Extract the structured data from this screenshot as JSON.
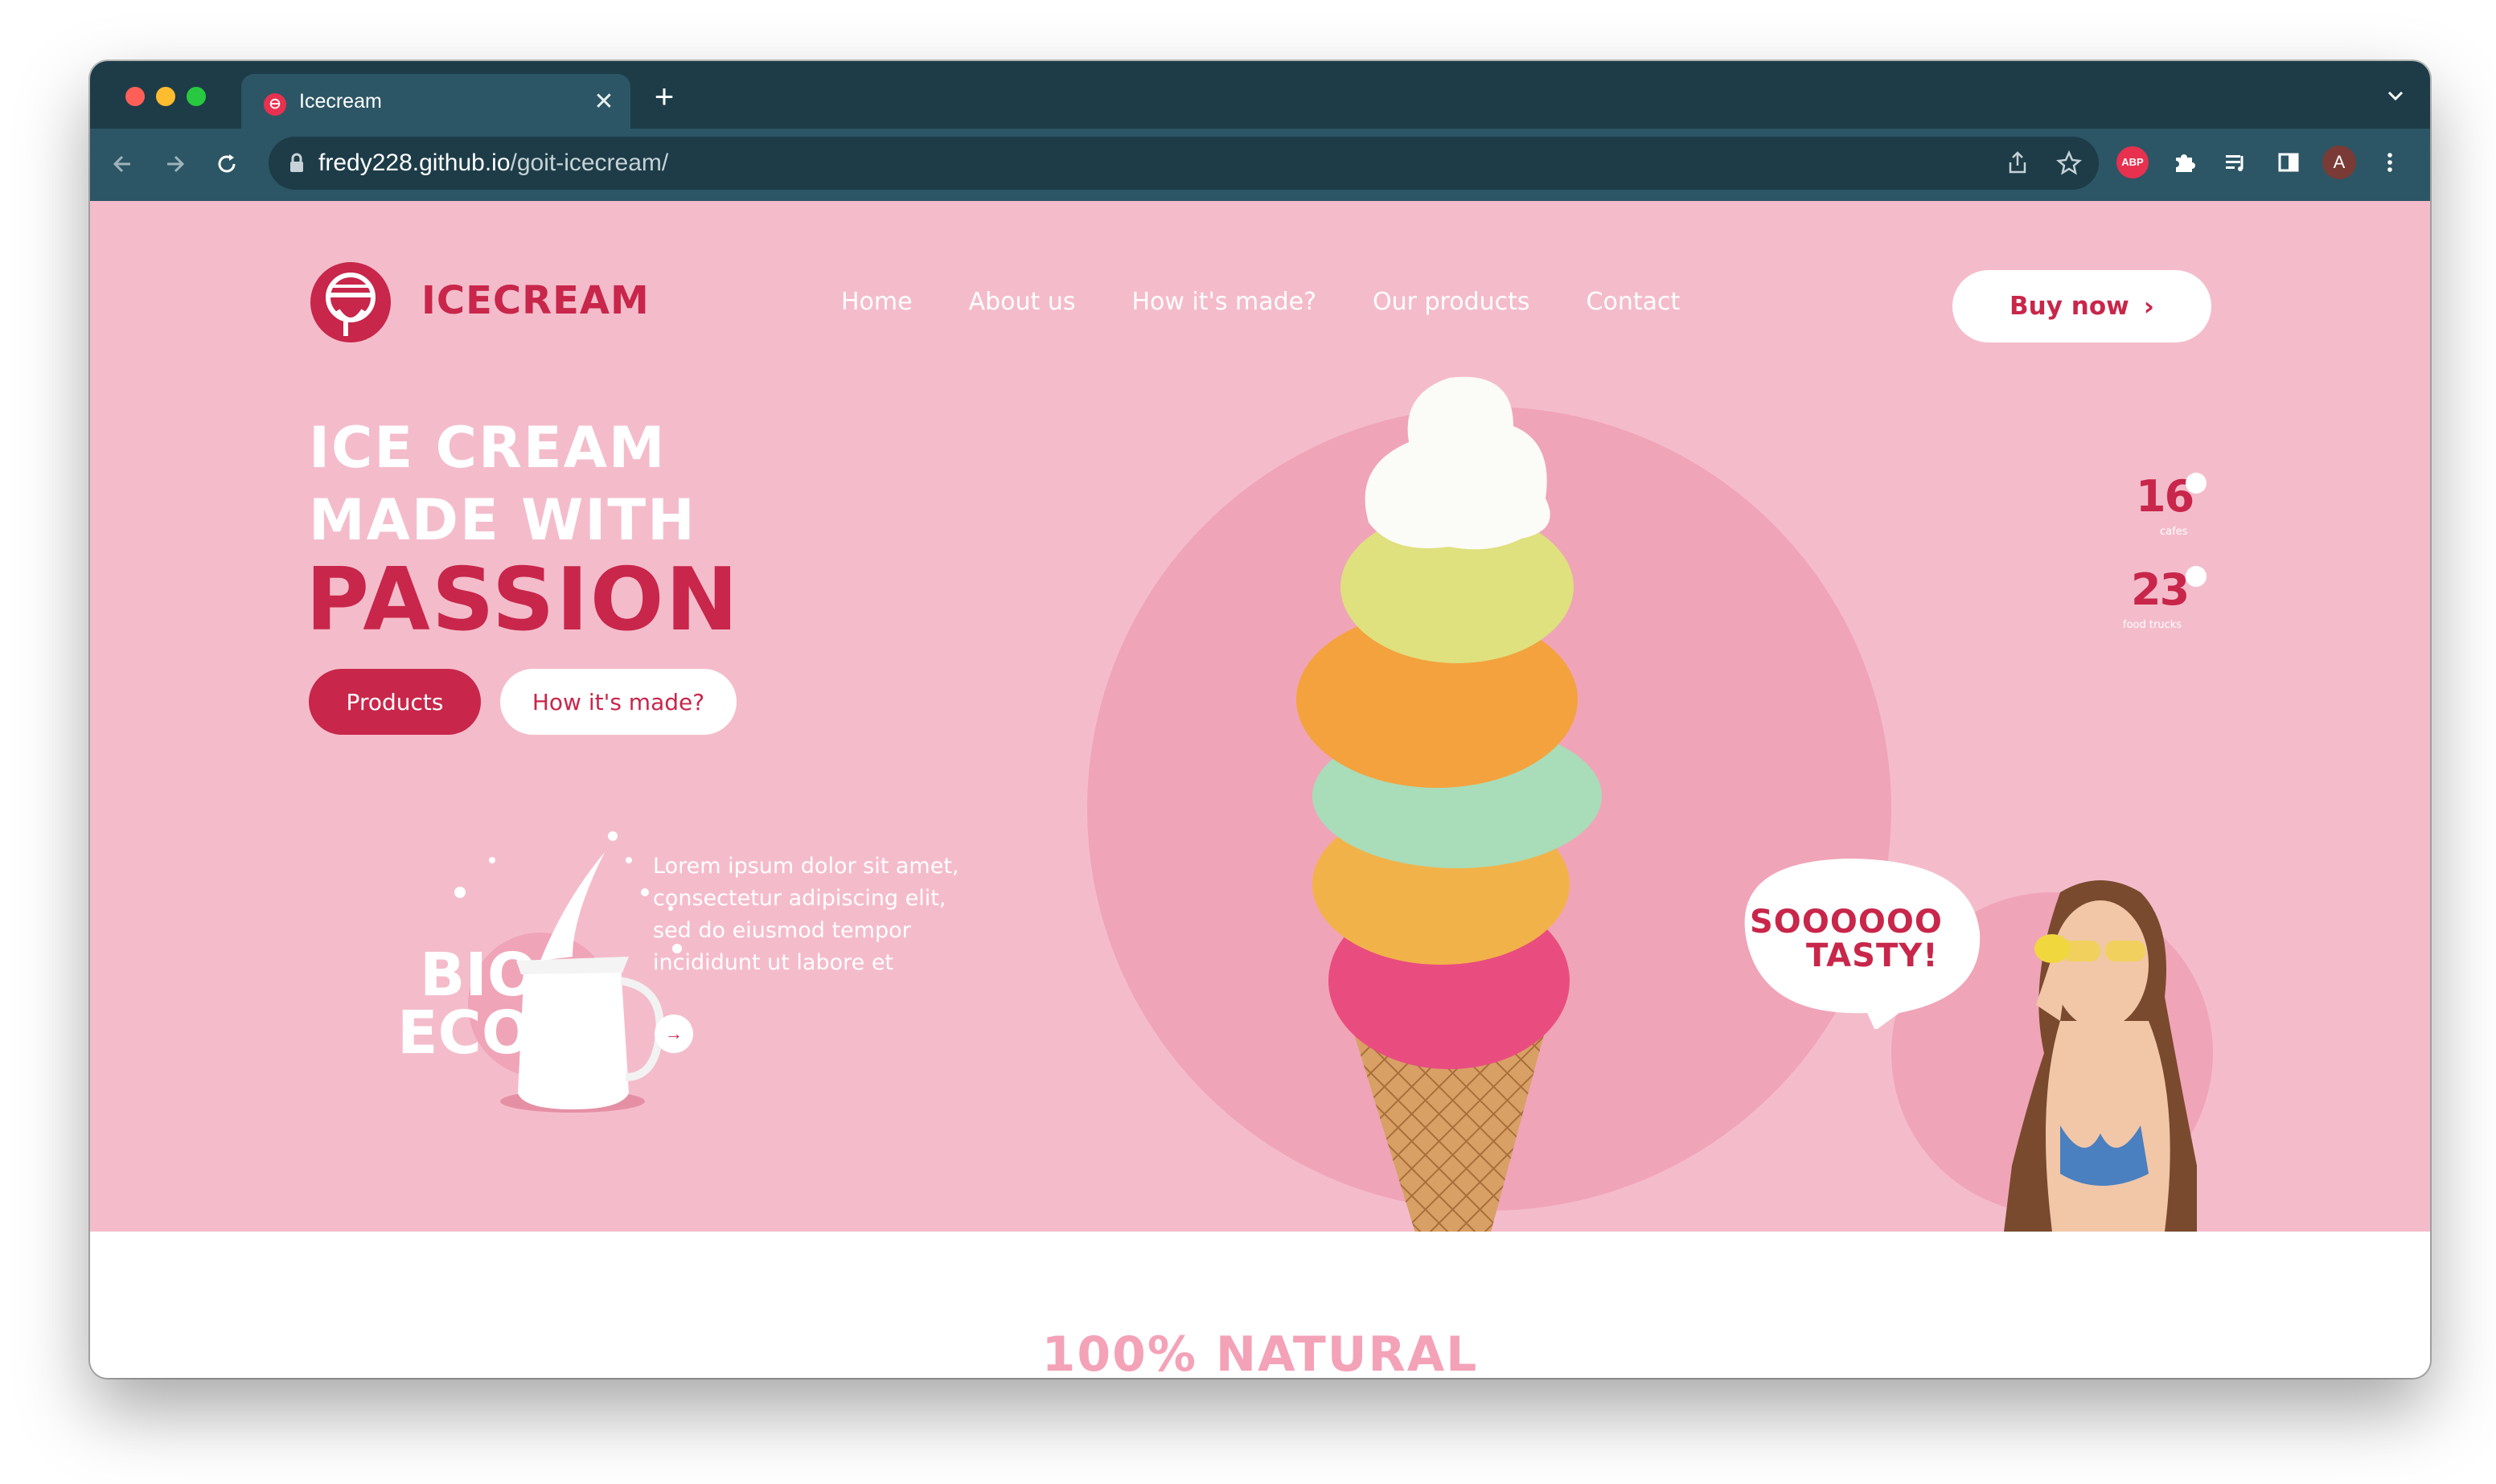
{
  "browser": {
    "tab_title": "Icecream",
    "url_host": "fredy228.github.io",
    "url_path": "/goit-icecream/",
    "extension_abp": "ABP",
    "profile_initial": "A",
    "icons": [
      "back-icon",
      "forward-icon",
      "reload-icon",
      "lock-icon",
      "share-icon",
      "star-icon",
      "puzzle-icon",
      "media-icon",
      "side-panel-icon",
      "kebab-icon",
      "close-icon",
      "plus-icon",
      "chevron-down-icon"
    ]
  },
  "header": {
    "brand": "ICECREAM",
    "nav": [
      "Home",
      "About us",
      "How it's made?",
      "Our products",
      "Contact"
    ],
    "buy_label": "Buy now",
    "buy_chevron": "›"
  },
  "hero": {
    "line1": "ICE CREAM",
    "line2": "MADE WITH",
    "line3": "PASSION",
    "btn_products": "Products",
    "btn_how": "How it's made?",
    "bio_word1": "BIO",
    "bio_word2": "ECO",
    "bio_text": "Lorem ipsum dolor sit amet, consectetur adipiscing elit, sed do eiusmod tempor incididunt ut labore et",
    "bio_arrow": "→",
    "stats": [
      {
        "value": "16",
        "caption": "cafes"
      },
      {
        "value": "23",
        "caption": "food trucks"
      }
    ],
    "bubble_line1": "SOOOOOO",
    "bubble_line2": "TASTY!"
  },
  "section2": {
    "title": "100% NATURAL"
  },
  "colors": {
    "primary": "#c8264a",
    "hero_bg": "#f4bccb",
    "circle": "#f0a4b8",
    "browser_dark": "#1d3c48",
    "browser_mid": "#2c5665"
  }
}
